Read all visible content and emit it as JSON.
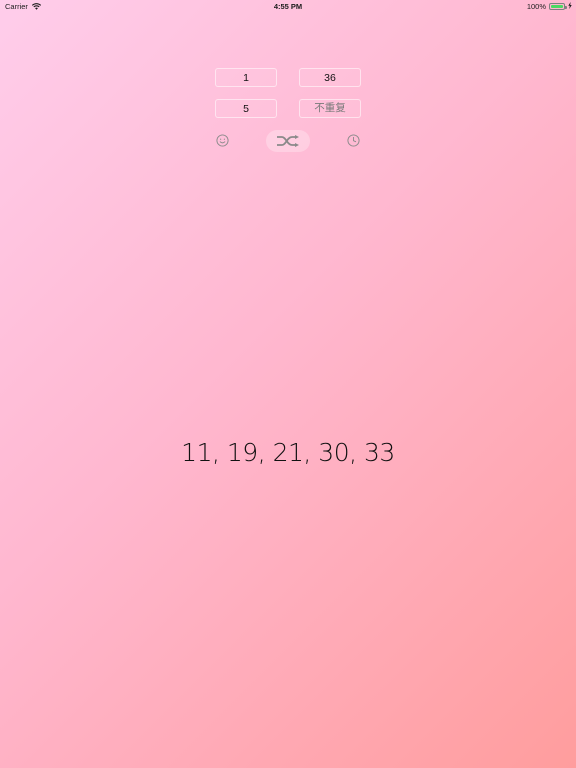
{
  "status_bar": {
    "carrier": "Carrier",
    "time": "4:55 PM",
    "battery_text": "100%",
    "battery_level": 1.0,
    "battery_color": "#4cd964"
  },
  "inputs": {
    "min_value": "1",
    "max_value": "36",
    "count_value": "5",
    "mode_label": "不重复"
  },
  "actions": {
    "left_icon": "smiley-icon",
    "center_icon": "shuffle-icon",
    "right_icon": "clock-icon"
  },
  "result": {
    "text": "11, 19, 21, 30, 33"
  },
  "theme": {
    "gradient_start": "#ffcdeb",
    "gradient_end": "#ff9d9d"
  }
}
